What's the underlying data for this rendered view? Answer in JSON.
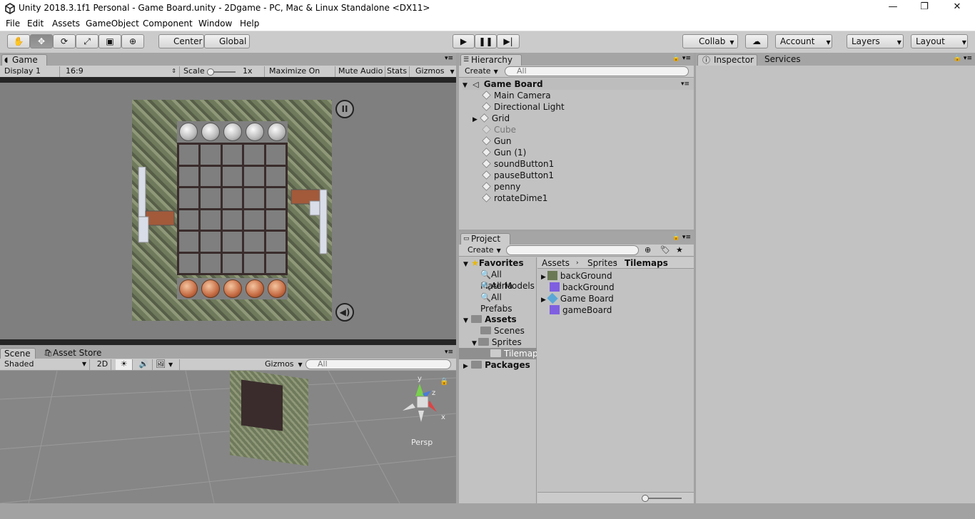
{
  "window": {
    "title": "Unity 2018.3.1f1 Personal - Game Board.unity - 2Dgame - PC, Mac & Linux Standalone <DX11>",
    "minimize_glyph": "—",
    "restore_glyph": "❐",
    "close_glyph": "✕"
  },
  "menu": [
    "File",
    "Edit",
    "Assets",
    "GameObject",
    "Component",
    "Window",
    "Help"
  ],
  "toolbar": {
    "tool_icons": [
      "hand-icon",
      "move-icon",
      "rotate-icon",
      "scale-icon",
      "rect-icon",
      "transform-icon"
    ],
    "pivot_label": "Center",
    "space_label": "Global",
    "play_glyph": "▶",
    "pause_glyph": "❚❚",
    "step_glyph": "▶|",
    "collab_label": "Collab",
    "account_label": "Account",
    "layers_label": "Layers",
    "layout_label": "Layout"
  },
  "game": {
    "tab_label": "Game",
    "display": "Display 1",
    "aspect": "16:9",
    "scale_label": "Scale",
    "scale_value": "1x",
    "maximize_on_play": "Maximize On Play",
    "mute_audio": "Mute Audio",
    "stats": "Stats",
    "gizmos": "Gizmos",
    "pause_btn_glyph": "II",
    "sound_btn_glyph": "◀)"
  },
  "scene": {
    "tab_label": "Scene",
    "asset_store_label": "Asset Store",
    "shading": "Shaded",
    "mode_2d": "2D",
    "gizmos": "Gizmos",
    "search_placeholder": "All",
    "persp_label": "Persp",
    "axis_y": "y",
    "axis_z": "z",
    "axis_x": "x"
  },
  "hierarchy": {
    "tab_label": "Hierarchy",
    "create_label": "Create",
    "search_placeholder": "All",
    "root": "Game Board",
    "items": [
      "Main Camera",
      "Directional Light",
      "Grid",
      "Cube",
      "Gun",
      "Gun (1)",
      "soundButton1",
      "pauseButton1",
      "penny",
      "rotateDime1"
    ]
  },
  "project": {
    "tab_label": "Project",
    "create_label": "Create",
    "favorites_label": "Favorites",
    "favorites": [
      "All Materia",
      "All Models",
      "All Prefabs"
    ],
    "assets_label": "Assets",
    "folders": [
      "Scenes",
      "Sprites",
      "Tilemaps"
    ],
    "packages_label": "Packages",
    "breadcrumb": [
      "Assets",
      "Sprites",
      "Tilemaps"
    ],
    "files": [
      "backGround",
      "backGround",
      "Game Board",
      "gameBoard"
    ]
  },
  "inspector": {
    "tab_label": "Inspector",
    "services_label": "Services"
  }
}
